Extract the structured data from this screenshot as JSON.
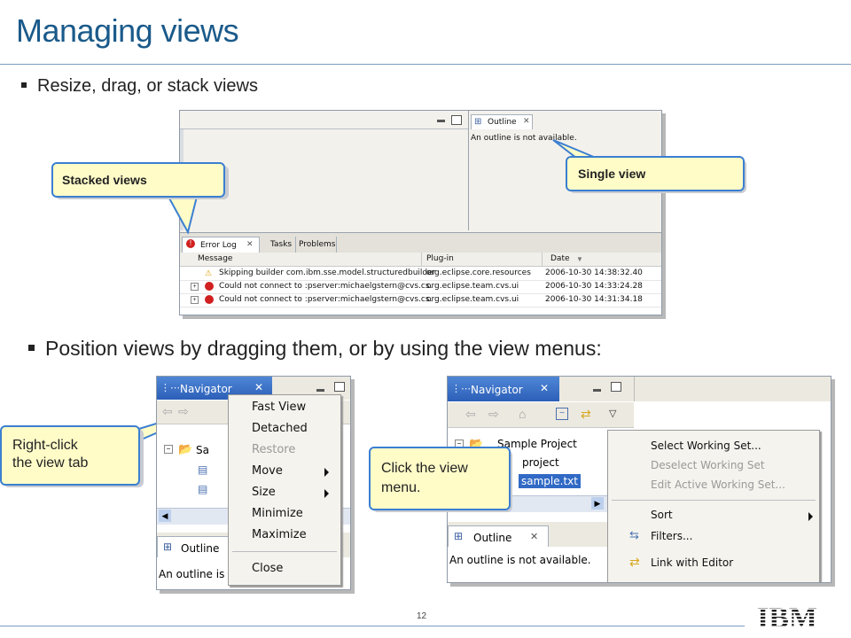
{
  "slide": {
    "title": "Managing views",
    "bullet1": "Resize, drag, or stack views",
    "bullet2": "Position views by dragging them, or by using the view menus:",
    "page_number": "12",
    "logo_text": "IBM"
  },
  "top_screenshot": {
    "outline_tab": "Outline",
    "outline_message": "An outline is not available.",
    "bottom_tabs": [
      "Error Log",
      "Tasks",
      "Problems"
    ],
    "columns": [
      "Message",
      "Plug-in",
      "Date"
    ],
    "rows": [
      {
        "message": "Skipping builder com.ibm.sse.model.structuredbuilder",
        "plugin": "org.eclipse.core.resources",
        "date": "2006-10-30 14:38:32.40"
      },
      {
        "message": "Could not connect to :pserver:michaelgstern@cvs.cs.",
        "plugin": "org.eclipse.team.cvs.ui",
        "date": "2006-10-30 14:33:24.28"
      },
      {
        "message": "Could not connect to :pserver:michaelgstern@cvs.cs.",
        "plugin": "org.eclipse.team.cvs.ui",
        "date": "2006-10-30 14:31:34.18"
      }
    ]
  },
  "callouts": {
    "stacked": "Stacked views",
    "single": "Single view",
    "right_click_line1": "Right-click",
    "right_click_line2": "the view tab",
    "view_menu_line1": "Click the view",
    "view_menu_line2": "menu."
  },
  "left_screenshot": {
    "nav_tab": "Navigator",
    "tree_label": "Sa",
    "outline_tab": "Outline",
    "outline_partial": "An outline is",
    "context_menu": [
      {
        "label": "Fast View",
        "disabled": false
      },
      {
        "label": "Detached",
        "disabled": false
      },
      {
        "label": "Restore",
        "disabled": true
      },
      {
        "label": "Move",
        "disabled": false,
        "submenu": true
      },
      {
        "label": "Size",
        "disabled": false,
        "submenu": true
      },
      {
        "label": "Minimize",
        "disabled": false
      },
      {
        "label": "Maximize",
        "disabled": false
      },
      {
        "label": "Close",
        "disabled": false
      }
    ]
  },
  "right_screenshot": {
    "nav_tab": "Navigator",
    "tree_items": [
      "Sample Project",
      "project",
      "sample.txt"
    ],
    "outline_tab": "Outline",
    "outline_message": "An outline is not available.",
    "view_menu": [
      {
        "label": "Select Working Set...",
        "disabled": false
      },
      {
        "label": "Deselect Working Set",
        "disabled": true
      },
      {
        "label": "Edit Active Working Set...",
        "disabled": true
      },
      {
        "label": "Sort",
        "disabled": false,
        "submenu": true
      },
      {
        "label": "Filters...",
        "disabled": false
      },
      {
        "label": "Link with Editor",
        "disabled": false
      }
    ]
  },
  "colors": {
    "title": "#1a5a8a",
    "callout_fill": "#fffcc8",
    "callout_border": "#3b7fd1",
    "nav_titlebar": "#2c5fb8"
  }
}
